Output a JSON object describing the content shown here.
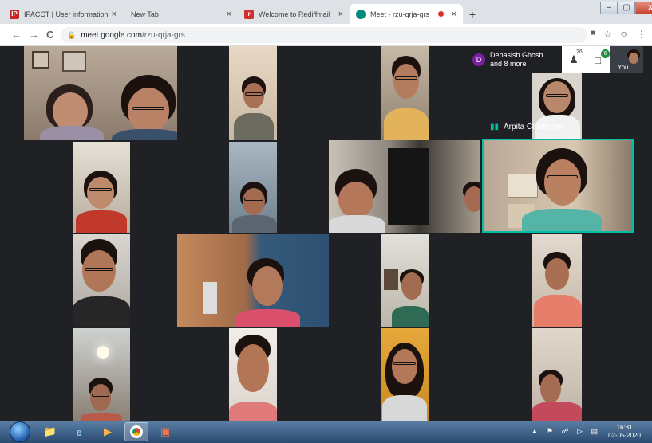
{
  "browser": {
    "tabs": [
      {
        "title": "IPACCT | User information portal",
        "favicon": "IP",
        "favicon_color": "#c62828",
        "active": false
      },
      {
        "title": "New Tab",
        "favicon": "",
        "active": false
      },
      {
        "title": "Welcome to Rediffmail",
        "favicon": "r",
        "favicon_color": "#d32f2f",
        "active": false
      },
      {
        "title": "Meet - rzu-qrja-grs",
        "favicon": "meet-icon",
        "favicon_color": "#00897b",
        "active": true
      }
    ],
    "close_glyph": "×",
    "new_tab_glyph": "+",
    "url_host": "meet.google.com",
    "url_path": "/rzu-qrja-grs",
    "nav": {
      "back": "←",
      "forward": "→",
      "reload": "C"
    },
    "window_controls": {
      "minimize": "–",
      "maximize": "▢",
      "close": "x"
    }
  },
  "meet": {
    "presenter_chip": {
      "avatar_letter": "D",
      "line1": "Debasish Ghosh",
      "line2": "and 8 more"
    },
    "participants_count": "26",
    "chat_badge": "6",
    "self_label": "You",
    "speaking_label": "Arpita Chatterjee",
    "accent": "#00bfa5"
  },
  "taskbar": {
    "time": "16:31",
    "date": "02-05-2020"
  }
}
